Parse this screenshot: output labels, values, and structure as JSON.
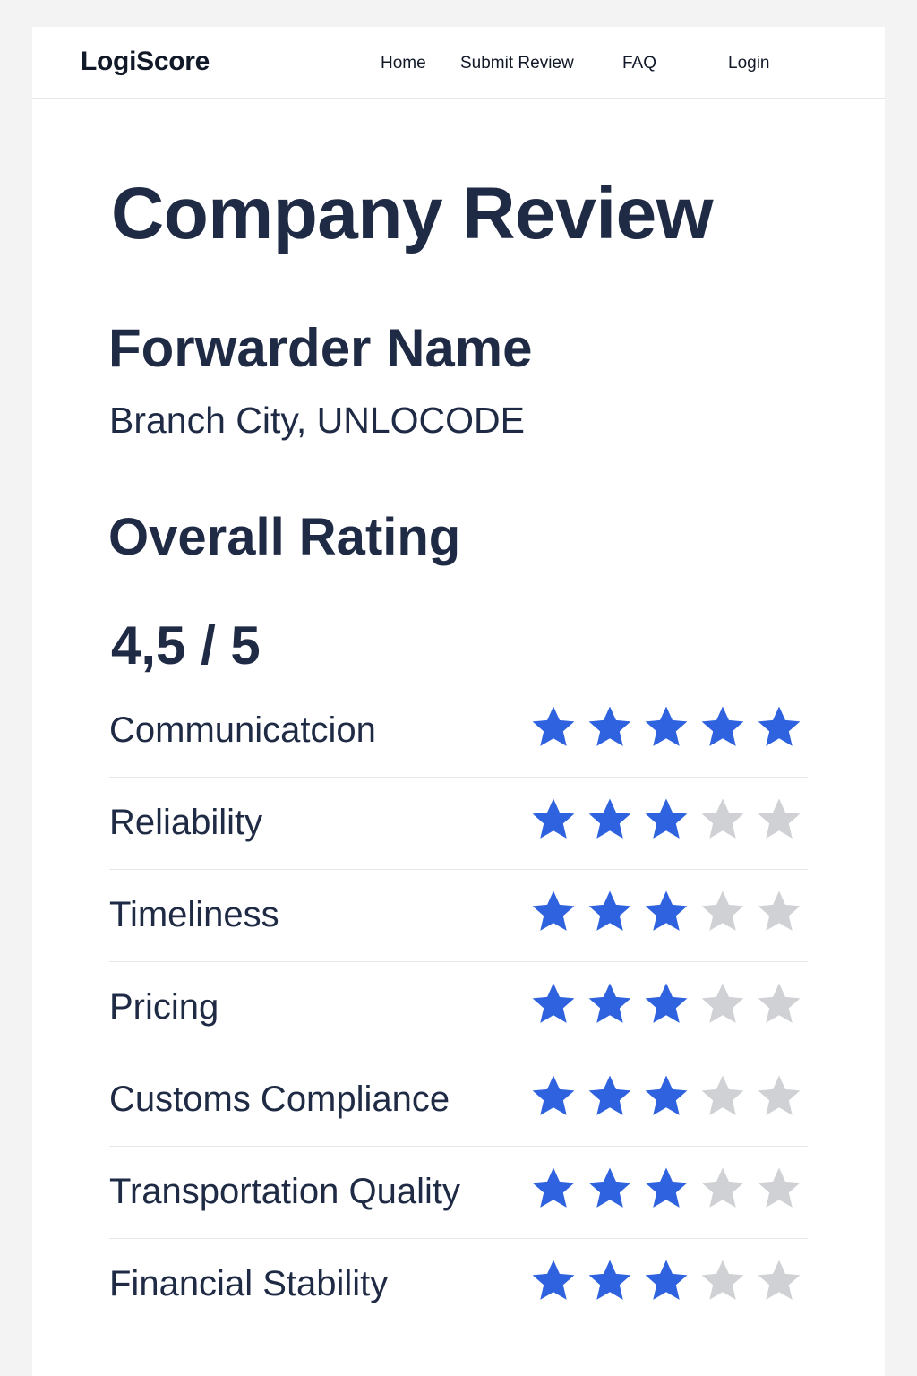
{
  "nav": {
    "logo": "LogiScore",
    "links": [
      "Home",
      "Submit Review",
      "FAQ",
      "Login"
    ]
  },
  "page": {
    "title": "Company Review",
    "forwarder_name": "Forwarder Name",
    "branch": "Branch City, UNLOCODE",
    "overall_heading": "Overall Rating",
    "overall_score": "4,5 / 5"
  },
  "colors": {
    "star_filled": "#2f62df",
    "star_empty": "#cfd1d4",
    "text": "#1f2a44"
  },
  "star_icon": "star-icon",
  "ratings": [
    {
      "label": "Communicatcion",
      "stars": 5,
      "max": 5
    },
    {
      "label": "Reliability",
      "stars": 3,
      "max": 5
    },
    {
      "label": "Timeliness",
      "stars": 3,
      "max": 5
    },
    {
      "label": "Pricing",
      "stars": 3,
      "max": 5
    },
    {
      "label": "Customs Compliance",
      "stars": 3,
      "max": 5
    },
    {
      "label": "Transportation Quality",
      "stars": 3,
      "max": 5
    },
    {
      "label": "Financial Stability",
      "stars": 3,
      "max": 5
    }
  ]
}
